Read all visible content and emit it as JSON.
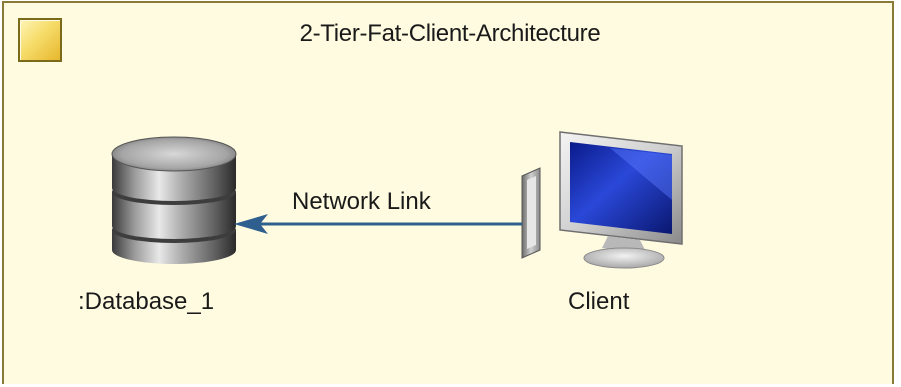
{
  "diagram": {
    "title": "2-Tier-Fat-Client-Architecture",
    "nodes": [
      {
        "label": ":Database_1",
        "icon": "database-icon"
      },
      {
        "label": "Client",
        "icon": "computer-icon"
      }
    ],
    "link": {
      "label": "Network Link",
      "from": "Client",
      "to": ":Database_1"
    }
  },
  "colors": {
    "frame_background": "#fffbe0",
    "frame_border": "#8a7a3a",
    "link_line": "#2f5f8f"
  }
}
